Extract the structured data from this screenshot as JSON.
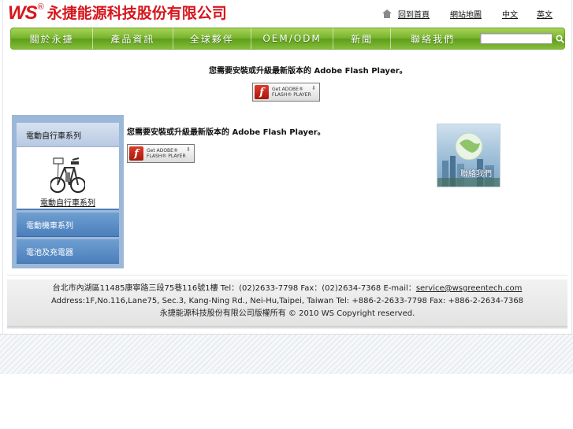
{
  "header": {
    "logo_ws": "WS",
    "logo_reg": "®",
    "logo_cn": "永捷能源科技股份有限公司",
    "top_links": [
      "回到首頁",
      "網站地圖",
      "中文",
      "英文"
    ]
  },
  "nav": {
    "items": [
      "關於永捷",
      "產品資訊",
      "全球夥伴",
      "OEM/ODM",
      "新聞",
      "聯絡我們"
    ],
    "search_placeholder": ""
  },
  "flash": {
    "message_top": "您需要安裝或升級最新版本的 Adobe Flash Player。",
    "message_mid": "您需要安裝或升級最新版本的 Adobe Flash Player。",
    "button_line1": "Get ADOBE®",
    "button_line2": "FLASH® PLAYER",
    "button_brand": "ADOBE®"
  },
  "sidebar": {
    "items": [
      "電動自行車系列",
      "電動機車系列",
      "電池及充電器"
    ],
    "product_label": "電動自行車系列"
  },
  "contact_image": {
    "label": "聯絡我們"
  },
  "footer": {
    "line1_prefix": "台北市內湖區11485康寧路三段75巷116號1樓 Tel：(02)2633-7798 Fax：(02)2634-7368 E-mail：",
    "email": "service@wsgreentech.com",
    "line2": "Address:1F,No.116,Lane75, Sec.3, Kang-Ning Rd., Nei-Hu,Taipei, Taiwan Tel: +886-2-2633-7798 Fax: +886-2-2634-7368",
    "line3": "永捷能源科技股份有限公司版權所有 © 2010 WS Copyright reserved."
  },
  "colors": {
    "brand_red": "#d7161d",
    "nav_green": "#79b62d",
    "sidebar_blue": "#4b7fbc",
    "panel_blue": "#9cb8d9"
  }
}
